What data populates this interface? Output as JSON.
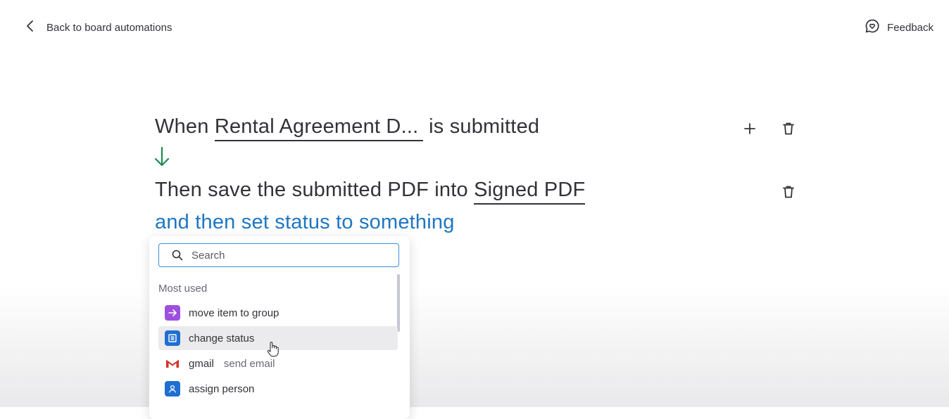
{
  "header": {
    "back_label": "Back to board automations",
    "feedback_label": "Feedback"
  },
  "recipe": {
    "trigger_prefix": "When",
    "trigger_form": "Rental Agreement D...",
    "trigger_suffix": "is submitted",
    "action_prefix": "Then save the submitted PDF into",
    "action_column": "Signed PDF",
    "followup": "and then set status to something"
  },
  "dropdown": {
    "search_placeholder": "Search",
    "section_title": "Most used",
    "items": [
      {
        "label": "move item to group",
        "sub": "",
        "icon": "arrow-right-icon",
        "color": "#9d50dd"
      },
      {
        "label": "change status",
        "sub": "",
        "icon": "status-column-icon",
        "color": "#1f6fd1"
      },
      {
        "label": "gmail",
        "sub": "send email",
        "icon": "gmail-icon",
        "color": "#d93025"
      },
      {
        "label": "assign person",
        "sub": "",
        "icon": "person-icon",
        "color": "#1f6fd1"
      }
    ]
  },
  "colors": {
    "accent_blue": "#1f76c2",
    "arrow_green": "#1e8a4c",
    "text": "#323338"
  }
}
